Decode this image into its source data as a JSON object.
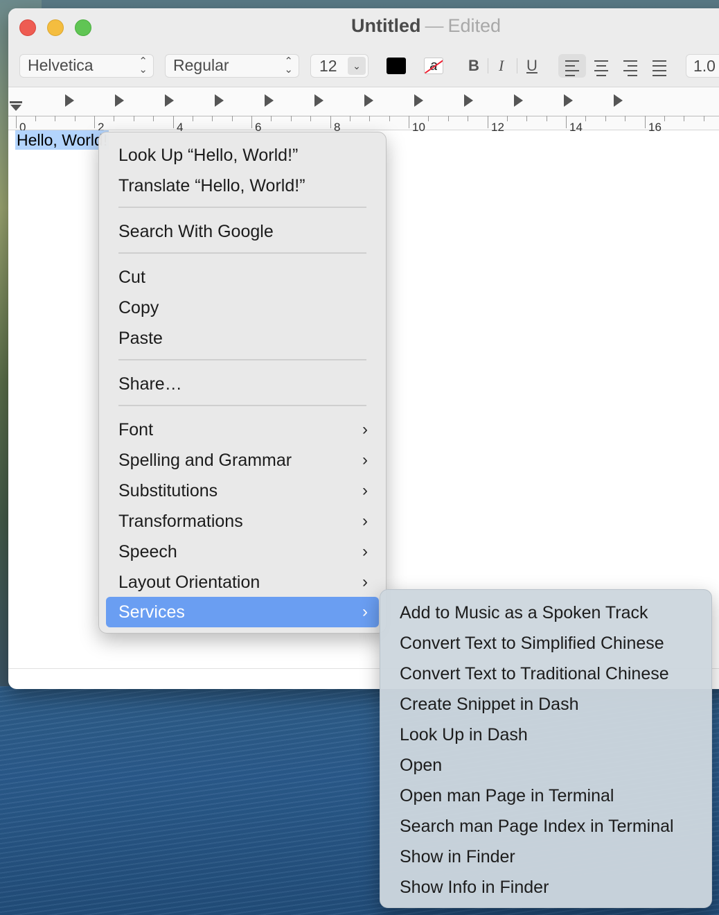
{
  "window": {
    "title": "Untitled",
    "separator": "—",
    "status": "Edited"
  },
  "toolbar": {
    "font_family": "Helvetica",
    "font_style": "Regular",
    "font_size": "12",
    "text_color": "#000000",
    "bold_label": "B",
    "italic_label": "I",
    "underline_label": "U",
    "line_spacing": "1.0",
    "highlight_glyph": "a",
    "alignment_selected": "left"
  },
  "ruler": {
    "labels": [
      "0",
      "2",
      "4",
      "6",
      "8",
      "10",
      "12",
      "14",
      "16"
    ]
  },
  "document": {
    "text": "Hello, World!"
  },
  "context_menu": {
    "items": [
      {
        "label": "Look Up “Hello, World!”"
      },
      {
        "label": "Translate “Hello, World!”"
      },
      {
        "label": "Search With Google"
      },
      {
        "label": "Cut"
      },
      {
        "label": "Copy"
      },
      {
        "label": "Paste"
      },
      {
        "label": "Share…"
      },
      {
        "label": "Font"
      },
      {
        "label": "Spelling and Grammar"
      },
      {
        "label": "Substitutions"
      },
      {
        "label": "Transformations"
      },
      {
        "label": "Speech"
      },
      {
        "label": "Layout Orientation"
      },
      {
        "label": "Services"
      }
    ],
    "highlighted": "Services"
  },
  "services_submenu": {
    "items": [
      {
        "label": "Add to Music as a Spoken Track"
      },
      {
        "label": "Convert Text to Simplified Chinese"
      },
      {
        "label": "Convert Text to Traditional Chinese"
      },
      {
        "label": "Create Snippet in Dash"
      },
      {
        "label": "Look Up in Dash"
      },
      {
        "label": "Open"
      },
      {
        "label": "Open man Page in Terminal"
      },
      {
        "label": "Search man Page Index in Terminal"
      },
      {
        "label": "Show in Finder"
      },
      {
        "label": "Show Info in Finder"
      }
    ]
  },
  "colors": {
    "selection_highlight": "#b3d4fc",
    "menu_highlight": "#6a9ef2",
    "close": "#ee5c52",
    "minimize": "#f4bd3f",
    "maximize": "#60c554"
  }
}
